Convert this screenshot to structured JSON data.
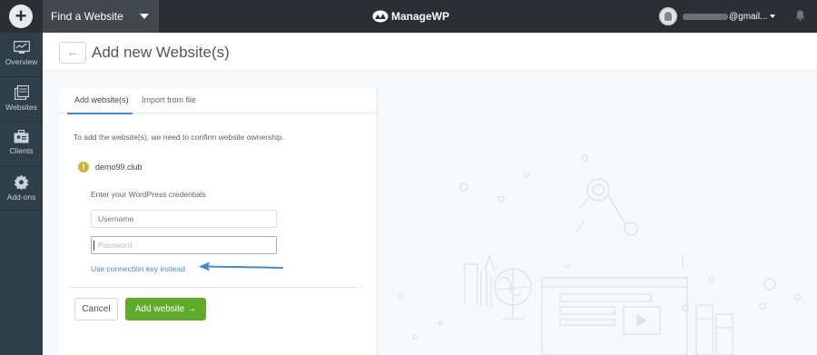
{
  "topbar": {
    "site_switcher_label": "Find a Website",
    "brand_name": "ManageWP",
    "user_email_suffix": "@gmail..."
  },
  "sidebar": {
    "items": [
      {
        "label": "Overview",
        "icon": "monitor-icon"
      },
      {
        "label": "Websites",
        "icon": "websites-icon"
      },
      {
        "label": "Clients",
        "icon": "clients-icon"
      },
      {
        "label": "Add-ons",
        "icon": "puzzle-icon"
      }
    ]
  },
  "page": {
    "back_icon": "←",
    "title": "Add new Website(s)"
  },
  "tabs": [
    {
      "label": "Add website(s)",
      "active": true
    },
    {
      "label": "Import from file",
      "active": false
    }
  ],
  "form": {
    "intro": "To add the website(s), we need to confirm website ownership.",
    "domain": "demo99.club",
    "warning_icon": "!",
    "credentials_label": "Enter your WordPress credentials",
    "username_placeholder": "Username",
    "password_placeholder": "Password",
    "connection_key_link": "Use connection key instead",
    "cancel_label": "Cancel",
    "add_label": "Add website →"
  },
  "colors": {
    "accent": "#3d8bce",
    "primary_button": "#5fab2c",
    "topbar": "#2b2f33",
    "sidebar": "#2f3f4a",
    "warning": "#c7b33c"
  }
}
